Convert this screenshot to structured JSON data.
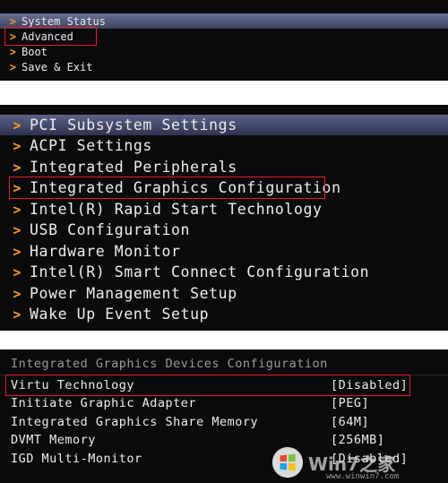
{
  "menu": {
    "items": [
      "System Status",
      "Advanced",
      "Boot",
      "Save & Exit"
    ]
  },
  "advanced": {
    "items": [
      "PCI Subsystem Settings",
      "ACPI Settings",
      "Integrated Peripherals",
      "Integrated Graphics Configuration",
      "Intel(R) Rapid Start Technology",
      "USB Configuration",
      "Hardware Monitor",
      "Intel(R) Smart Connect Configuration",
      "Power Management Setup",
      "Wake Up Event Setup"
    ]
  },
  "graphics": {
    "title": "Integrated Graphics Devices Configuration",
    "rows": [
      {
        "label": "Virtu Technology",
        "value": "[Disabled]"
      },
      {
        "label": "Initiate Graphic Adapter",
        "value": "[PEG]"
      },
      {
        "label": "Integrated Graphics Share Memory",
        "value": "[64M]"
      },
      {
        "label": "DVMT Memory",
        "value": "[256MB]"
      },
      {
        "label": "IGD Multi-Monitor",
        "value": "[Disabled]"
      }
    ]
  },
  "watermark": {
    "text": "Win7之家",
    "url": "www.winwin7.com"
  },
  "colors": {
    "background": "#0b0b0d",
    "chevron": "#ff9a2e",
    "highlight_box": "#e02020",
    "selection": "#5d6287"
  }
}
